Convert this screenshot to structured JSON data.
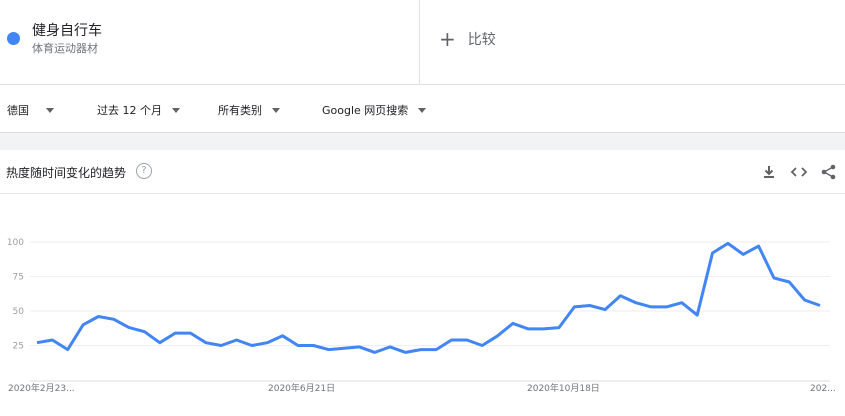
{
  "term": {
    "title": "健身自行车",
    "subtitle": "体育运动器材",
    "color": "#4285f4"
  },
  "compare": {
    "label": "比较"
  },
  "filters": {
    "region": "德国",
    "time": "过去 12 个月",
    "category": "所有类别",
    "search_type": "Google 网页搜索"
  },
  "card": {
    "title": "热度随时间变化的趋势",
    "help": "?"
  },
  "icons": [
    "download-icon",
    "embed-icon",
    "share-icon",
    "help-icon",
    "plus-icon",
    "chevron-down-icon"
  ],
  "chart_data": {
    "type": "line",
    "series": [
      {
        "values": [
          27,
          29,
          22,
          40,
          46,
          44,
          38,
          35,
          27,
          34,
          34,
          27,
          25,
          29,
          25,
          27,
          32,
          25,
          25,
          22,
          23,
          24,
          20,
          24,
          20,
          22,
          22,
          29,
          29,
          25,
          32,
          41,
          37,
          37,
          38,
          53,
          54,
          51,
          61,
          56,
          53,
          53,
          56,
          47,
          92,
          99,
          91,
          97,
          74,
          71,
          58,
          54
        ],
        "color": "#4285f4"
      }
    ],
    "y_ticks": [
      "100",
      "75",
      "50",
      "25"
    ],
    "ylim": [
      0,
      100
    ],
    "x_ticks": [
      "2020年2月23...",
      "2020年6月21日",
      "2020年10月18日",
      "202..."
    ],
    "grid": true
  }
}
